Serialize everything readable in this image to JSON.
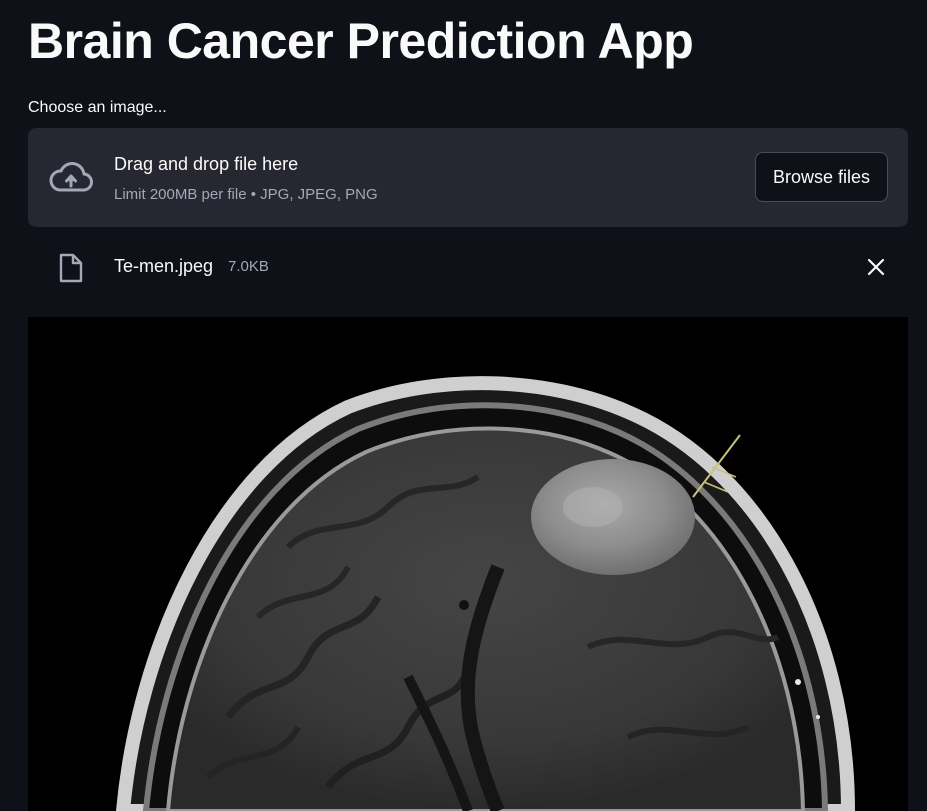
{
  "page": {
    "title": "Brain Cancer Prediction App"
  },
  "uploader": {
    "label": "Choose an image...",
    "dropzone_title": "Drag and drop file here",
    "dropzone_hint": "Limit 200MB per file • JPG, JPEG, PNG",
    "browse_label": "Browse files",
    "icons": {
      "upload": "cloud-upload-icon"
    }
  },
  "uploaded_file": {
    "name": "Te-men.jpeg",
    "size": "7.0KB",
    "icons": {
      "file": "file-icon",
      "remove": "close-icon"
    }
  },
  "colors": {
    "background": "#0e1117",
    "dropzone_bg": "#262730",
    "text": "#fafafa",
    "muted_text": "#a3a8b8"
  }
}
